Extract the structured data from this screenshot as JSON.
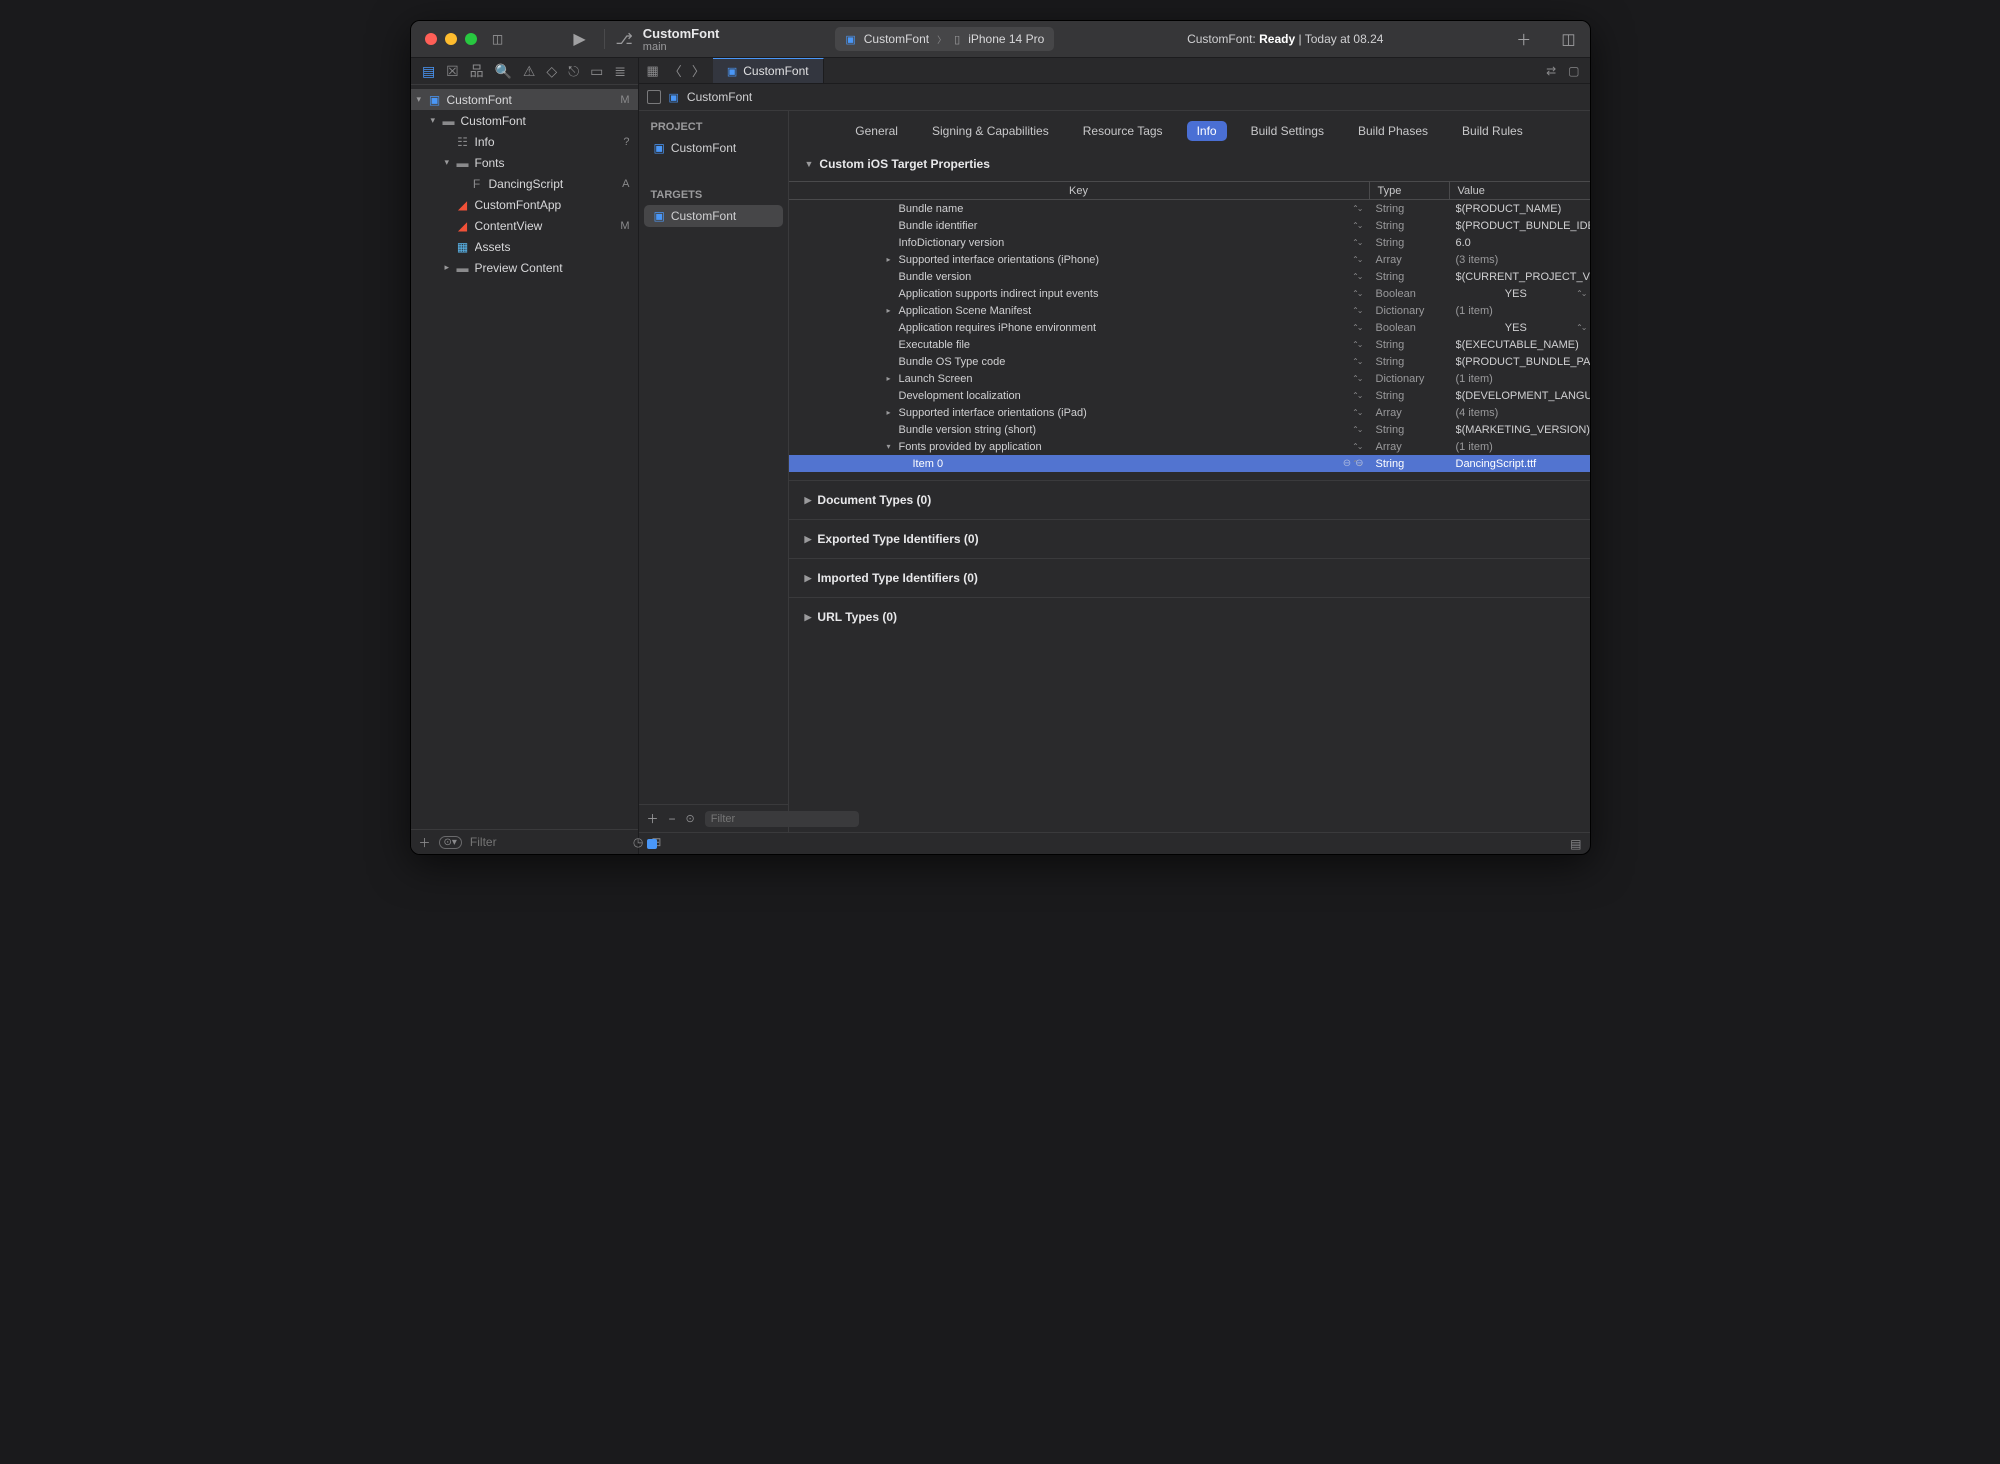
{
  "project_name": "CustomFont",
  "branch": "main",
  "scheme": {
    "name": "CustomFont",
    "device": "iPhone 14 Pro"
  },
  "status": {
    "prefix": "CustomFont:",
    "state": "Ready",
    "suffix": "| Today at 08.24"
  },
  "navigator": {
    "filter_placeholder": "Filter",
    "items": [
      {
        "indent": 0,
        "disc": "▾",
        "icn": "proj",
        "label": "CustomFont",
        "badge": "M",
        "sel": true
      },
      {
        "indent": 1,
        "disc": "▾",
        "icn": "fold",
        "label": "CustomFont",
        "badge": ""
      },
      {
        "indent": 2,
        "disc": "",
        "icn": "plist",
        "label": "Info",
        "badge": "?"
      },
      {
        "indent": 2,
        "disc": "▾",
        "icn": "fold",
        "label": "Fonts",
        "badge": ""
      },
      {
        "indent": 3,
        "disc": "",
        "icn": "font",
        "label": "DancingScript",
        "badge": "A"
      },
      {
        "indent": 2,
        "disc": "",
        "icn": "swift",
        "label": "CustomFontApp",
        "badge": ""
      },
      {
        "indent": 2,
        "disc": "",
        "icn": "swift",
        "label": "ContentView",
        "badge": "M"
      },
      {
        "indent": 2,
        "disc": "",
        "icn": "assets",
        "label": "Assets",
        "badge": ""
      },
      {
        "indent": 2,
        "disc": "▸",
        "icn": "fold",
        "label": "Preview Content",
        "badge": ""
      }
    ]
  },
  "crumb": "CustomFont",
  "left_list": {
    "project_head": "PROJECT",
    "project_item": "CustomFont",
    "targets_head": "TARGETS",
    "target_item": "CustomFont",
    "filter_placeholder": "Filter"
  },
  "tabs": [
    "General",
    "Signing & Capabilities",
    "Resource Tags",
    "Info",
    "Build Settings",
    "Build Phases",
    "Build Rules"
  ],
  "active_tab": 3,
  "sections": {
    "props": "Custom iOS Target Properties",
    "doc": "Document Types (0)",
    "exp": "Exported Type Identifiers (0)",
    "imp": "Imported Type Identifiers (0)",
    "url": "URL Types (0)"
  },
  "table_head": {
    "key": "Key",
    "type": "Type",
    "value": "Value"
  },
  "rows": [
    {
      "arrow": "",
      "depth": 0,
      "key": "Bundle name",
      "type": "String",
      "value": "$(PRODUCT_NAME)",
      "dim": true
    },
    {
      "arrow": "",
      "depth": 0,
      "key": "Bundle identifier",
      "type": "String",
      "value": "$(PRODUCT_BUNDLE_IDE",
      "dim": true
    },
    {
      "arrow": "",
      "depth": 0,
      "key": "InfoDictionary version",
      "type": "String",
      "value": "6.0",
      "dim": true
    },
    {
      "arrow": "▸",
      "depth": 0,
      "key": "Supported interface orientations (iPhone)",
      "type": "Array",
      "value": "(3 items)",
      "dim": true,
      "vdim": true
    },
    {
      "arrow": "",
      "depth": 0,
      "key": "Bundle version",
      "type": "String",
      "value": "$(CURRENT_PROJECT_VE",
      "dim": true
    },
    {
      "arrow": "",
      "depth": 0,
      "key": "Application supports indirect input events",
      "type": "Boolean",
      "value": "YES",
      "dim": true,
      "bool": true
    },
    {
      "arrow": "▸",
      "depth": 0,
      "key": "Application Scene Manifest",
      "type": "Dictionary",
      "value": "(1 item)",
      "dim": true,
      "vdim": true
    },
    {
      "arrow": "",
      "depth": 0,
      "key": "Application requires iPhone environment",
      "type": "Boolean",
      "value": "YES",
      "dim": true,
      "bool": true
    },
    {
      "arrow": "",
      "depth": 0,
      "key": "Executable file",
      "type": "String",
      "value": "$(EXECUTABLE_NAME)",
      "dim": true
    },
    {
      "arrow": "",
      "depth": 0,
      "key": "Bundle OS Type code",
      "type": "String",
      "value": "$(PRODUCT_BUNDLE_PA",
      "dim": true
    },
    {
      "arrow": "▸",
      "depth": 0,
      "key": "Launch Screen",
      "type": "Dictionary",
      "value": "(1 item)",
      "dim": true,
      "vdim": true
    },
    {
      "arrow": "",
      "depth": 0,
      "key": "Development localization",
      "type": "String",
      "value": "$(DEVELOPMENT_LANGU",
      "dim": true
    },
    {
      "arrow": "▸",
      "depth": 0,
      "key": "Supported interface orientations (iPad)",
      "type": "Array",
      "value": "(4 items)",
      "dim": true,
      "vdim": true
    },
    {
      "arrow": "",
      "depth": 0,
      "key": "Bundle version string (short)",
      "type": "String",
      "value": "$(MARKETING_VERSION)",
      "dim": true
    },
    {
      "arrow": "▾",
      "depth": 0,
      "key": "Fonts provided by application",
      "type": "Array",
      "value": "(1 item)",
      "dim": true,
      "vdim": true
    },
    {
      "arrow": "",
      "depth": 1,
      "key": "Item 0",
      "type": "String",
      "value": "DancingScript.ttf",
      "sel": true
    }
  ]
}
